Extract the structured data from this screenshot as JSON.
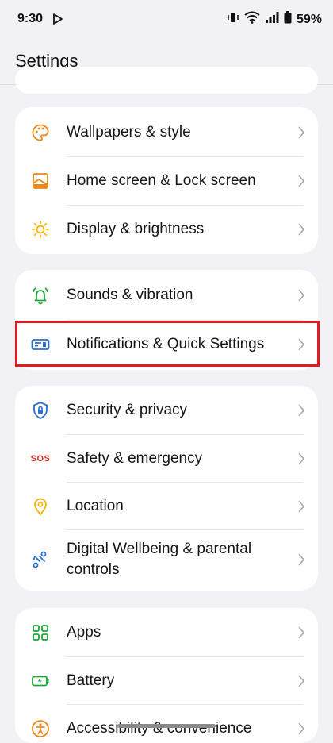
{
  "status_bar": {
    "time": "9:30",
    "battery_percent": "59%"
  },
  "header": {
    "title": "Settings"
  },
  "groups": [
    {
      "items": [
        {
          "label": "Wallpapers & style",
          "icon": "palette-icon"
        },
        {
          "label": "Home screen & Lock screen",
          "icon": "home-screen-icon"
        },
        {
          "label": "Display & brightness",
          "icon": "sun-icon"
        }
      ]
    },
    {
      "items": [
        {
          "label": "Sounds & vibration",
          "icon": "bell-ringing-icon"
        },
        {
          "label": "Notifications & Quick Settings",
          "icon": "notifications-panel-icon"
        }
      ]
    },
    {
      "items": [
        {
          "label": "Security & privacy",
          "icon": "shield-lock-icon"
        },
        {
          "label": "Safety & emergency",
          "icon": "sos-icon"
        },
        {
          "label": "Location",
          "icon": "location-pin-icon"
        },
        {
          "label": "Digital Wellbeing & parental controls",
          "icon": "wellbeing-icon"
        }
      ]
    },
    {
      "items": [
        {
          "label": "Apps",
          "icon": "apps-grid-icon"
        },
        {
          "label": "Battery",
          "icon": "battery-icon"
        },
        {
          "label": "Accessibility & convenience",
          "icon": "accessibility-icon"
        }
      ]
    }
  ],
  "sos_text": "SOS",
  "colors": {
    "highlight": "#e01b24",
    "orange": "#e98a1c",
    "yellow": "#f2b705",
    "green": "#1fa83a",
    "blue": "#2a6fd1",
    "red": "#d0302b"
  }
}
